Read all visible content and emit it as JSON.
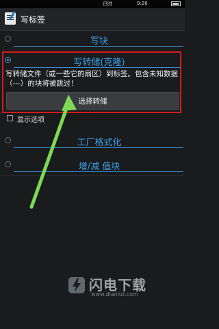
{
  "statusbar": {
    "carrier": "已时",
    "time": "9:26"
  },
  "app": {
    "title": "写标签"
  },
  "options": {
    "write_block": "写块",
    "write_dump": "写转储(克隆)",
    "factory_format": "工厂格式化",
    "inc_dec_value": "增/减 值块"
  },
  "dump": {
    "description": "写转储文件（或一些它的扇区）到标签。包含未知数据（---）的块将被跳过！",
    "select_button": "选择转储"
  },
  "show_options": {
    "label": "显示选项"
  },
  "watermark": {
    "brand": "闪电下载",
    "url": "www.dianlut.com"
  },
  "colors": {
    "accent": "#3aa0e8",
    "highlight": "#d21d1d",
    "arrow": "#7ed957"
  }
}
